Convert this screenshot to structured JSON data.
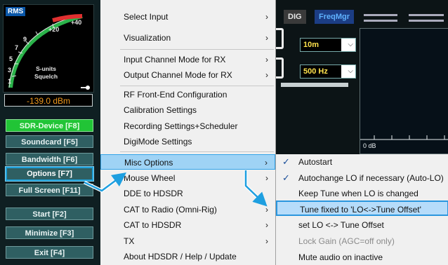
{
  "left_panel": {
    "meter": {
      "badge": "RMS",
      "ticks": [
        "+40",
        "+20",
        "9",
        "7",
        "5",
        "3",
        "1"
      ],
      "labels": [
        "S-units",
        "Squelch"
      ]
    },
    "level_readout": "-139.0 dBm",
    "buttons": [
      {
        "label": "SDR-Device [F8]",
        "style": "grn"
      },
      {
        "label": "Soundcard [F5]",
        "style": "std"
      },
      {
        "label": "Bandwidth [F6]",
        "style": "std"
      },
      {
        "label": "Options  [F7]",
        "style": "sel"
      },
      {
        "label": "Full Screen [F11]",
        "style": "std"
      },
      {
        "label": "Start     [F2]",
        "style": "std"
      },
      {
        "label": "Minimize [F3]",
        "style": "std"
      },
      {
        "label": "Exit      [F4]",
        "style": "std"
      }
    ]
  },
  "background_app": {
    "dig_label": "DIG",
    "freqmgr_label": "FreqMgr",
    "band_select": "10m",
    "bw_select": "500 Hz",
    "scale_label": "0 dB"
  },
  "main_menu": [
    {
      "label": "Select Input",
      "submenu": true
    },
    {
      "label": "Visualization",
      "submenu": true
    },
    {
      "label": "Input Channel Mode for RX",
      "submenu": true
    },
    {
      "label": "Output Channel Mode for RX",
      "submenu": true
    },
    {
      "label": "RF Front-End Configuration",
      "submenu": false
    },
    {
      "label": "Calibration Settings",
      "submenu": false
    },
    {
      "label": "Recording Settings+Scheduler",
      "submenu": false
    },
    {
      "label": "DigiMode Settings",
      "submenu": false
    },
    {
      "label": "Misc Options",
      "submenu": true
    },
    {
      "label": "Mouse Wheel",
      "submenu": true
    },
    {
      "label": "DDE to HDSDR",
      "submenu": false
    },
    {
      "label": "CAT to Radio (Omni-Rig)",
      "submenu": true
    },
    {
      "label": "CAT to HDSDR",
      "submenu": true
    },
    {
      "label": "TX",
      "submenu": true
    },
    {
      "label": "About HDSDR / Help / Update",
      "submenu": false
    }
  ],
  "sub_menu": [
    {
      "label": "Autostart",
      "checked": true,
      "disabled": false
    },
    {
      "label": "Autochange LO if necessary (Auto-LO)",
      "checked": true,
      "disabled": false
    },
    {
      "label": "Keep Tune when LO is changed",
      "checked": false,
      "disabled": false
    },
    {
      "label": "Tune fixed to 'LO<->Tune Offset'",
      "checked": false,
      "disabled": false
    },
    {
      "label": "set LO <-> Tune Offset",
      "checked": false,
      "disabled": false
    },
    {
      "label": "Lock Gain (AGC=off only)",
      "checked": false,
      "disabled": true
    },
    {
      "label": "Mute audio on inactive",
      "checked": false,
      "disabled": false
    }
  ],
  "glyphs": {
    "submenu_arrow": "›",
    "check": "✓",
    "dropdown": "⌵"
  }
}
